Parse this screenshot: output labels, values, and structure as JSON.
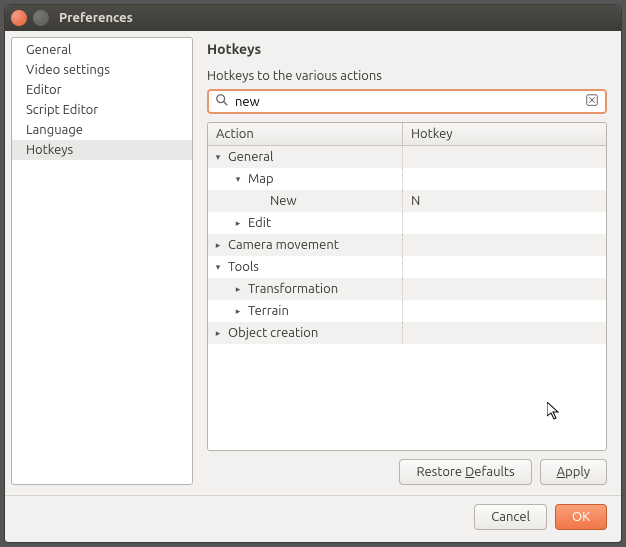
{
  "window": {
    "title": "Preferences"
  },
  "sidebar": {
    "items": [
      {
        "label": "General"
      },
      {
        "label": "Video settings"
      },
      {
        "label": "Editor"
      },
      {
        "label": "Script Editor"
      },
      {
        "label": "Language"
      },
      {
        "label": "Hotkeys"
      }
    ],
    "selected_index": 5
  },
  "panel": {
    "heading": "Hotkeys",
    "subtitle": "Hotkeys to the various actions"
  },
  "search": {
    "value": "new",
    "placeholder": ""
  },
  "columns": {
    "action": "Action",
    "hotkey": "Hotkey"
  },
  "tree": [
    {
      "label": "General",
      "hotkey": "",
      "expanded": true,
      "level": 0,
      "icon": "down"
    },
    {
      "label": "Map",
      "hotkey": "",
      "expanded": true,
      "level": 1,
      "icon": "down"
    },
    {
      "label": "New",
      "hotkey": "N",
      "expanded": null,
      "level": 2,
      "icon": ""
    },
    {
      "label": "Edit",
      "hotkey": "",
      "expanded": false,
      "level": 1,
      "icon": "right"
    },
    {
      "label": "Camera movement",
      "hotkey": "",
      "expanded": false,
      "level": 0,
      "icon": "right"
    },
    {
      "label": "Tools",
      "hotkey": "",
      "expanded": true,
      "level": 0,
      "icon": "down"
    },
    {
      "label": "Transformation",
      "hotkey": "",
      "expanded": false,
      "level": 1,
      "icon": "right"
    },
    {
      "label": "Terrain",
      "hotkey": "",
      "expanded": false,
      "level": 1,
      "icon": "right"
    },
    {
      "label": "Object creation",
      "hotkey": "",
      "expanded": false,
      "level": 0,
      "icon": "right"
    }
  ],
  "buttons": {
    "restore_defaults": "Restore Defaults",
    "apply": "Apply",
    "cancel": "Cancel",
    "ok": "OK"
  }
}
